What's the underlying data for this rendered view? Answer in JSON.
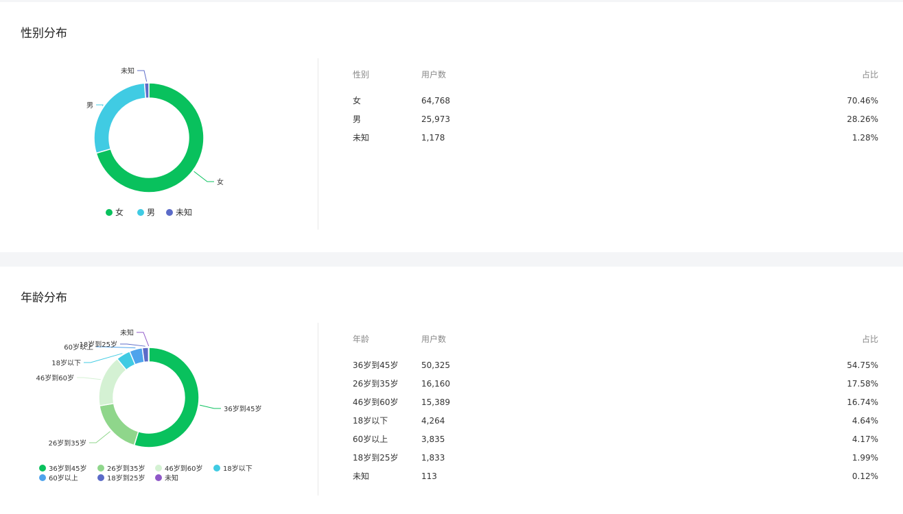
{
  "colors": {
    "green": "#09c15d",
    "cyan": "#40cbe3",
    "indigo": "#5b6bc8",
    "light_green": "#8fd68b",
    "pale_green": "#d4f1d3",
    "blue": "#4ea3ec",
    "purple": "#8f58c8"
  },
  "gender": {
    "title": "性别分布",
    "table_headers": {
      "label": "性别",
      "users": "用户数",
      "ratio": "占比"
    },
    "rows": [
      {
        "label": "女",
        "users": "64,768",
        "ratio": "70.46%"
      },
      {
        "label": "男",
        "users": "25,973",
        "ratio": "28.26%"
      },
      {
        "label": "未知",
        "users": "1,178",
        "ratio": "1.28%"
      }
    ]
  },
  "age": {
    "title": "年龄分布",
    "table_headers": {
      "label": "年龄",
      "users": "用户数",
      "ratio": "占比"
    },
    "rows": [
      {
        "label": "36岁到45岁",
        "users": "50,325",
        "ratio": "54.75%"
      },
      {
        "label": "26岁到35岁",
        "users": "16,160",
        "ratio": "17.58%"
      },
      {
        "label": "46岁到60岁",
        "users": "15,389",
        "ratio": "16.74%"
      },
      {
        "label": "18岁以下",
        "users": "4,264",
        "ratio": "4.64%"
      },
      {
        "label": "60岁以上",
        "users": "3,835",
        "ratio": "4.17%"
      },
      {
        "label": "18岁到25岁",
        "users": "1,833",
        "ratio": "1.99%"
      },
      {
        "label": "未知",
        "users": "113",
        "ratio": "0.12%"
      }
    ]
  },
  "chart_data": [
    {
      "type": "pie",
      "variant": "donut",
      "categories": [
        "女",
        "男",
        "未知"
      ],
      "values": [
        64768,
        25973,
        1178
      ],
      "colors": [
        "#09c15d",
        "#40cbe3",
        "#5b6bc8"
      ],
      "legend": "bottom"
    },
    {
      "type": "pie",
      "variant": "donut",
      "categories": [
        "36岁到45岁",
        "26岁到35岁",
        "46岁到60岁",
        "18岁以下",
        "60岁以上",
        "18岁到25岁",
        "未知"
      ],
      "values": [
        50325,
        16160,
        15389,
        4264,
        3835,
        1833,
        113
      ],
      "colors": [
        "#09c15d",
        "#8fd68b",
        "#d4f1d3",
        "#40cbe3",
        "#4ea3ec",
        "#5b6bc8",
        "#8f58c8"
      ],
      "legend": "bottom"
    }
  ]
}
